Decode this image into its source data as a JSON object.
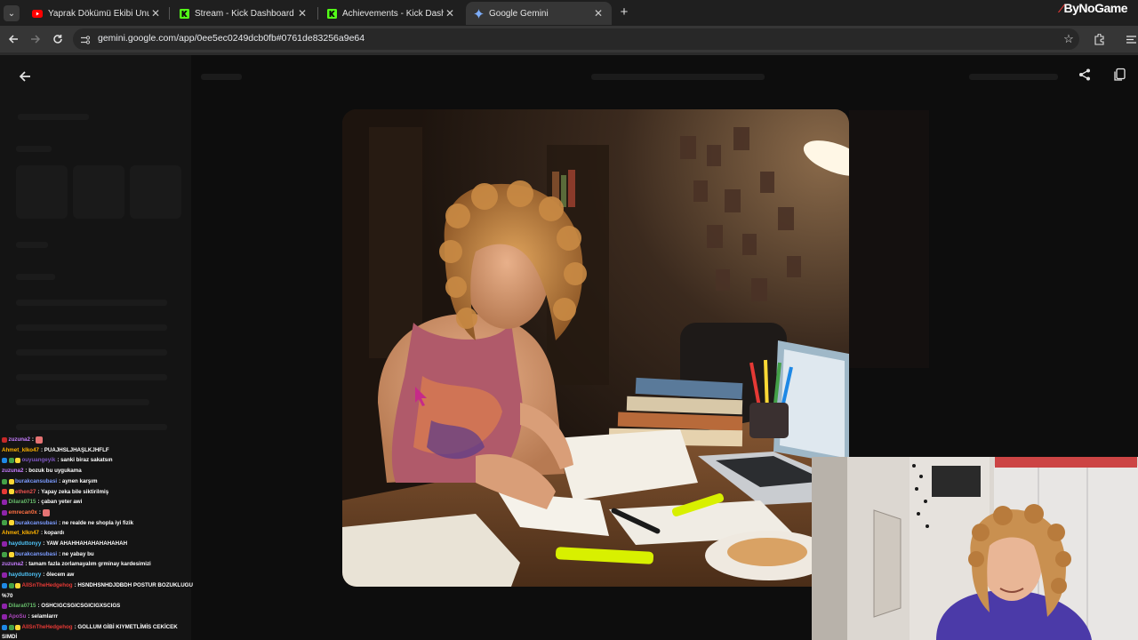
{
  "browser": {
    "tabs": [
      {
        "title": "Yaprak Dökümü Ekibi Unutulmaz",
        "favicon": "youtube-icon",
        "active": false
      },
      {
        "title": "Stream - Kick Dashboard",
        "favicon": "kick-icon",
        "active": false
      },
      {
        "title": "Achievements - Kick Dashboard",
        "favicon": "kick-icon",
        "active": false
      },
      {
        "title": "Google Gemini",
        "favicon": "gemini-icon",
        "active": true
      }
    ],
    "url": "gemini.google.com/app/0ee5ec0249dcb0fb#0761de83256a9e64",
    "overlay_brand": "ByNoGame"
  },
  "chat": [
    {
      "user": "zuzuna2",
      "msg": "",
      "color": "#c77dff",
      "badges": [
        "#c62828"
      ],
      "emote": true
    },
    {
      "user": "Ahmet_klko47",
      "msg": "PUAJHSLJHAŞLKJHFLF",
      "color": "#ffb300",
      "badges": []
    },
    {
      "user": "ouyuangeyik",
      "msg": "sanki biraz sakatsın",
      "color": "#7e57c2",
      "badges": [
        "#1e88e5",
        "#43a047",
        "#fdd835"
      ]
    },
    {
      "user": "zuzuna2",
      "msg": "bozuk bu uygukama",
      "color": "#c77dff",
      "badges": []
    },
    {
      "user": "burakcansubasi",
      "msg": "aynen karşım",
      "color": "#7c9cff",
      "badges": [
        "#43a047",
        "#fdd835"
      ]
    },
    {
      "user": "ethen27",
      "msg": "Yapay zeka bile siktirilmiş",
      "color": "#ef5350",
      "badges": [
        "#e53935",
        "#fdd835"
      ]
    },
    {
      "user": "Dilara0715",
      "msg": "çaban yeter awi",
      "color": "#66bb6a",
      "badges": [
        "#8e24aa"
      ]
    },
    {
      "user": "emrecan0x",
      "msg": "",
      "color": "#ff7043",
      "badges": [
        "#8e24aa"
      ],
      "emote": true
    },
    {
      "user": "burakcansubasi",
      "msg": "ne realde ne shopla iyi fizik",
      "color": "#7c9cff",
      "badges": [
        "#43a047",
        "#fdd835"
      ]
    },
    {
      "user": "Ahmet_klkn47",
      "msg": "kopardı",
      "color": "#ffb300",
      "badges": []
    },
    {
      "user": "hayduttonyy",
      "msg": "YAW AHAHHAHAHAHAHAHAH",
      "color": "#4fc3f7",
      "badges": [
        "#8e24aa"
      ]
    },
    {
      "user": "burakcansubasi",
      "msg": "ne yabay bu",
      "color": "#7c9cff",
      "badges": [
        "#43a047",
        "#fdd835"
      ]
    },
    {
      "user": "zuzuna2",
      "msg": "tamam fazla zorlamayalım grminay kardesimizi",
      "color": "#c77dff",
      "badges": []
    },
    {
      "user": "hayduttonyy",
      "msg": "ölecem aw",
      "color": "#4fc3f7",
      "badges": [
        "#8e24aa"
      ]
    },
    {
      "user": "AllSnTheHedgehog",
      "msg": "HSNDHSNHDJDBDH POSTUR BOZUKLUGU",
      "cont": "%70",
      "color": "#e53935",
      "badges": [
        "#1e88e5",
        "#43a047",
        "#fdd835"
      ]
    },
    {
      "user": "Dilara0715",
      "msg": "OSHCIGCSGICSGICIGXSCIGS",
      "color": "#66bb6a",
      "badges": [
        "#8e24aa"
      ]
    },
    {
      "user": "ApoSu",
      "msg": "selamlarrr",
      "color": "#ab47bc",
      "badges": [
        "#8e24aa"
      ]
    },
    {
      "user": "AllSnTheHedgehog",
      "msg": "GOLLUM GİBİ KIYMETLİMİS CEKİCEK",
      "cont": "SIMDİ",
      "color": "#e53935",
      "badges": [
        "#1e88e5",
        "#43a047",
        "#fdd835"
      ]
    }
  ],
  "colors": {
    "tabstrip": "#1f1f1f",
    "toolbar": "#363636",
    "page": "#0d0d0d"
  }
}
